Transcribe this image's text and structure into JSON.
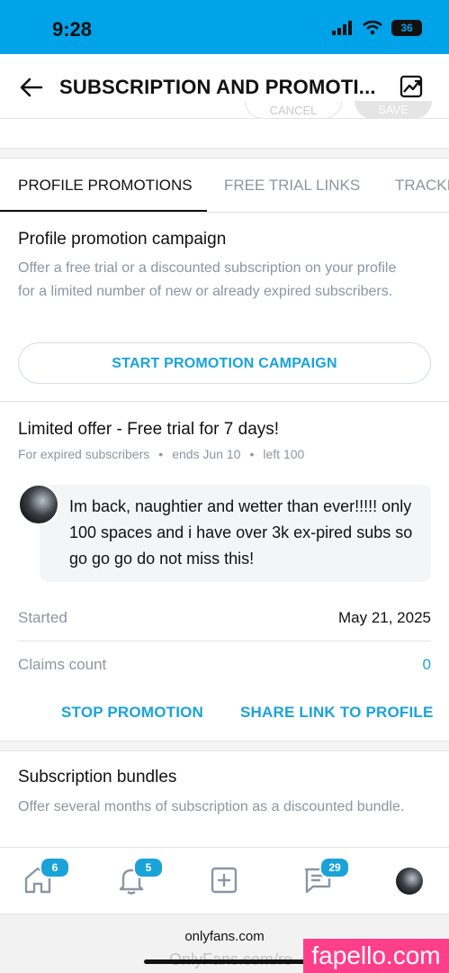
{
  "status_bar": {
    "time": "9:28",
    "battery": "36"
  },
  "header": {
    "title": "SUBSCRIPTION AND PROMOTI...",
    "back_icon": "arrow-left-icon",
    "action_icon": "image-chart-icon"
  },
  "ghost_buttons": {
    "cancel": "CANCEL",
    "save": "SAVE"
  },
  "tabs": [
    {
      "label": "PROFILE PROMOTIONS",
      "active": true
    },
    {
      "label": "FREE TRIAL LINKS",
      "active": false
    },
    {
      "label": "TRACKI",
      "active": false
    }
  ],
  "promotion_campaign": {
    "title": "Profile promotion campaign",
    "description": "Offer a free trial or a discounted subscription on your profile for a limited number of new or already expired subscribers.",
    "button_label": "START PROMOTION CAMPAIGN"
  },
  "offer": {
    "title": "Limited offer - Free trial for 7 days!",
    "meta": [
      "For expired subscribers",
      "ends Jun 10",
      "left 100"
    ],
    "separator": "•",
    "message": "Im back, naughtier and wetter than ever!!!!! only 100 spaces and i have over 3k ex-pired subs so go go go do not miss this!",
    "started_label": "Started",
    "started_value": "May 21, 2025",
    "claims_label": "Claims count",
    "claims_value": "0",
    "stop_label": "STOP PROMOTION",
    "share_label": "SHARE LINK TO PROFILE"
  },
  "bundles": {
    "title": "Subscription bundles",
    "description": "Offer several months of subscription as a discounted bundle."
  },
  "bottom_nav": [
    {
      "name": "home-icon",
      "badge": "6"
    },
    {
      "name": "bell-icon",
      "badge": "5"
    },
    {
      "name": "add-post-icon",
      "badge": ""
    },
    {
      "name": "messages-icon",
      "badge": "29"
    },
    {
      "name": "profile-avatar",
      "badge": ""
    }
  ],
  "browser": {
    "url": "onlyfans.com",
    "url_ghost": "OnlyFans.com/re"
  },
  "watermark": "fapello.com",
  "colors": {
    "accent": "#00a2e8",
    "link": "#1aa3d9",
    "muted": "#8a96a3",
    "badge_bg": "#1aa3d9",
    "watermark_bg": "#ff3f8a"
  }
}
